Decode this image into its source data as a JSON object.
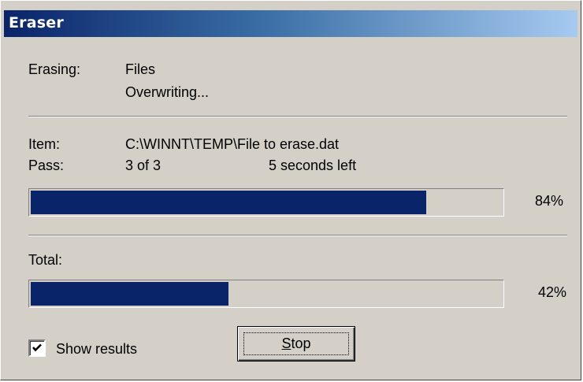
{
  "window": {
    "title": "Eraser"
  },
  "status": {
    "erasing_label": "Erasing:",
    "erasing_value": "Files",
    "operation": "Overwriting..."
  },
  "item": {
    "label": "Item:",
    "path": "C:\\WINNT\\TEMP\\File to erase.dat"
  },
  "pass": {
    "label": "Pass:",
    "value": "3 of 3",
    "time_left": "5 seconds left"
  },
  "pass_progress": {
    "percent": 84,
    "percent_label": "84%"
  },
  "total": {
    "label": "Total:",
    "percent": 42,
    "percent_label": "42%"
  },
  "show_results": {
    "label": "Show results",
    "checked": true
  },
  "stop_button": {
    "accel": "S",
    "rest": "top"
  },
  "colors": {
    "face": "#d4d0c8",
    "progress_fill": "#0a246a",
    "title_gradient_start": "#0a246a",
    "title_gradient_end": "#a6caf0"
  }
}
